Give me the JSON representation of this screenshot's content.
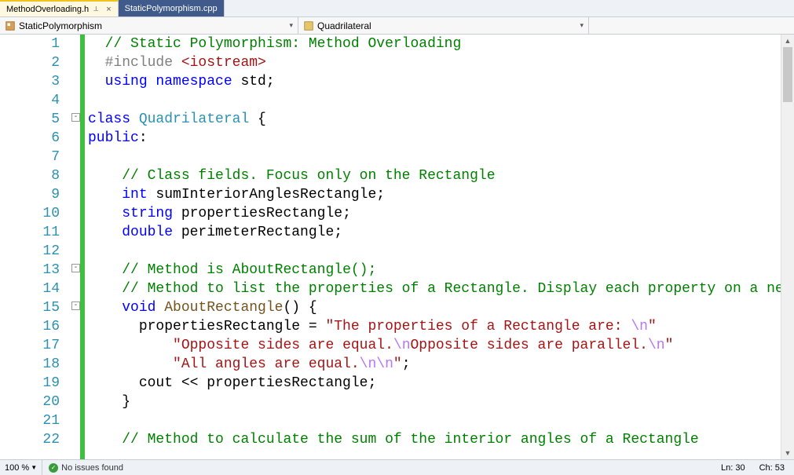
{
  "tabs": {
    "active": "MethodOverloading.h",
    "inactive": "StaticPolymorphism.cpp"
  },
  "nav": {
    "scope": "StaticPolymorphism",
    "member": "Quadrilateral"
  },
  "status": {
    "zoom": "100 %",
    "issues": "No issues found",
    "line_label": "Ln: 30",
    "col_label": "Ch: 53"
  },
  "code": {
    "l1_comment": "// Static Polymorphism: Method Overloading",
    "l2_a": "#include ",
    "l2_b": "<iostream>",
    "l3_a": "using",
    "l3_b": " namespace",
    "l3_c": " std;",
    "l5_a": "class",
    "l5_b": " Quadrilateral",
    "l5_c": " {",
    "l6_a": "public",
    "l6_b": ":",
    "l8_comment": "// Class fields. Focus only on the Rectangle",
    "l9_a": "int",
    "l9_b": " sumInteriorAnglesRectangle;",
    "l10_a": "string",
    "l10_b": " propertiesRectangle;",
    "l11_a": "double",
    "l11_b": " perimeterRectangle;",
    "l13_comment": "// Method is AboutRectangle();",
    "l14_comment": "// Method to list the properties of a Rectangle. Display each property on a new line",
    "l15_a": "void",
    "l15_b": " AboutRectangle",
    "l15_c": "() {",
    "l16_a": "propertiesRectangle = ",
    "l16_b": "\"The properties of a Rectangle are: ",
    "l16_c": "\\n",
    "l16_d": "\"",
    "l17_a": "\"Opposite sides are equal.",
    "l17_b": "\\n",
    "l17_c": "Opposite sides are parallel.",
    "l17_d": "\\n",
    "l17_e": "\"",
    "l18_a": "\"All angles are equal.",
    "l18_b": "\\n\\n",
    "l18_c": "\"",
    "l18_d": ";",
    "l19_a": "cout << propertiesRectangle;",
    "l20_a": "}",
    "l22_comment": "// Method to calculate the sum of the interior angles of a Rectangle"
  },
  "lines": [
    "1",
    "2",
    "3",
    "4",
    "5",
    "6",
    "7",
    "8",
    "9",
    "10",
    "11",
    "12",
    "13",
    "14",
    "15",
    "16",
    "17",
    "18",
    "19",
    "20",
    "21",
    "22"
  ]
}
